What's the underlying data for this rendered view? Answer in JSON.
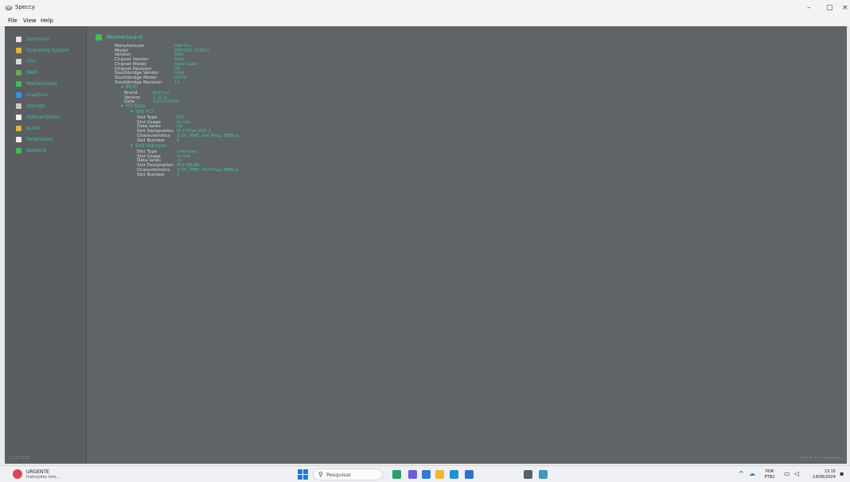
{
  "window": {
    "title": "Speccy",
    "minimize": "–",
    "maximize": "▢",
    "close": "×"
  },
  "menu": [
    "File",
    "View",
    "Help"
  ],
  "sidebar": {
    "items": [
      {
        "label": "Summary",
        "icon": "summary-icon",
        "color": "#e3e3e3"
      },
      {
        "label": "Operating System",
        "icon": "windows-icon",
        "color": "#e0b43a"
      },
      {
        "label": "CPU",
        "icon": "cpu-icon",
        "color": "#d8d8d8"
      },
      {
        "label": "RAM",
        "icon": "ram-icon",
        "color": "#6aa84f"
      },
      {
        "label": "Motherboard",
        "icon": "motherboard-icon",
        "color": "#3cbf52"
      },
      {
        "label": "Graphics",
        "icon": "graphics-icon",
        "color": "#3d8fd8"
      },
      {
        "label": "Storage",
        "icon": "storage-icon",
        "color": "#c8c8c8"
      },
      {
        "label": "Optical Drives",
        "icon": "optical-drive-icon",
        "color": "#f0f0f0"
      },
      {
        "label": "Audio",
        "icon": "audio-icon",
        "color": "#e0b43a"
      },
      {
        "label": "Peripherals",
        "icon": "mouse-icon",
        "color": "#f0f0f0"
      },
      {
        "label": "Network",
        "icon": "network-icon",
        "color": "#3cbf52"
      }
    ]
  },
  "motherboard": {
    "title": "Motherboard",
    "props": [
      {
        "k": "Manufacturer",
        "v": "Dell Inc."
      },
      {
        "k": "Model",
        "v": "0PH1DX (U3E1)"
      },
      {
        "k": "Version",
        "v": "A00"
      },
      {
        "k": "Chipset Vendor",
        "v": "Intel"
      },
      {
        "k": "Chipset Model",
        "v": "Alder Lake"
      },
      {
        "k": "Chipset Revision",
        "v": "05"
      },
      {
        "k": "Southbridge Vendor",
        "v": "Intel"
      },
      {
        "k": "Southbridge Model",
        "v": "Q570"
      },
      {
        "k": "Southbridge Revision",
        "v": "11"
      }
    ],
    "bios_label": "BIOS",
    "bios": [
      {
        "k": "Brand",
        "v": "Dell Inc."
      },
      {
        "k": "Version",
        "v": "1.11.0"
      },
      {
        "k": "Date",
        "v": "19/12/2023"
      }
    ],
    "pci_label": "PCI Data",
    "slot_pci_label": "Slot PCI",
    "slot_pci": [
      {
        "k": "Slot Type",
        "v": "PCI"
      },
      {
        "k": "Slot Usage",
        "v": "In Use"
      },
      {
        "k": "Data lanes",
        "v": "x4"
      },
      {
        "k": "Slot Designation",
        "v": "M.2 PCIe SSD-1"
      },
      {
        "k": "Characteristics",
        "v": "3.3V, PME, Hot Plug, SMBus"
      },
      {
        "k": "Slot Number",
        "v": "0"
      }
    ],
    "slot_unknown_label": "Slot Unknown",
    "slot_unknown": [
      {
        "k": "Slot Type",
        "v": "Unknown"
      },
      {
        "k": "Slot Usage",
        "v": "In Use"
      },
      {
        "k": "Data lanes",
        "v": "x1"
      },
      {
        "k": "Slot Designation",
        "v": "M.2 WLAN"
      },
      {
        "k": "Characteristics",
        "v": "3.3V, PME, Hot Plug, SMBus"
      },
      {
        "k": "Slot Number",
        "v": "1"
      }
    ]
  },
  "status": {
    "version": "v1.33.075",
    "updates": "Check for updates..."
  },
  "taskbar": {
    "weather_title": "URGENTE",
    "weather_sub": "Instruções tom...",
    "search_placeholder": "Pesquisar",
    "apps": [
      {
        "name": "widgets-app-icon",
        "color": "#2e9e6b"
      },
      {
        "name": "chat-app-icon",
        "color": "#6f5bd6"
      },
      {
        "name": "photos-app-icon",
        "color": "#2e7bd1"
      },
      {
        "name": "explorer-app-icon",
        "color": "#f2b52e"
      },
      {
        "name": "edge-app-icon",
        "color": "#1f8fd6"
      },
      {
        "name": "store-app-icon",
        "color": "#2b73c9"
      },
      {
        "name": "settings-app-icon",
        "color": "#58606b"
      },
      {
        "name": "speccy-app-icon",
        "color": "#3e98c4"
      }
    ],
    "lang_top": "POR",
    "lang_bottom": "PTB2",
    "time": "13:15",
    "date": "14/06/2024"
  }
}
